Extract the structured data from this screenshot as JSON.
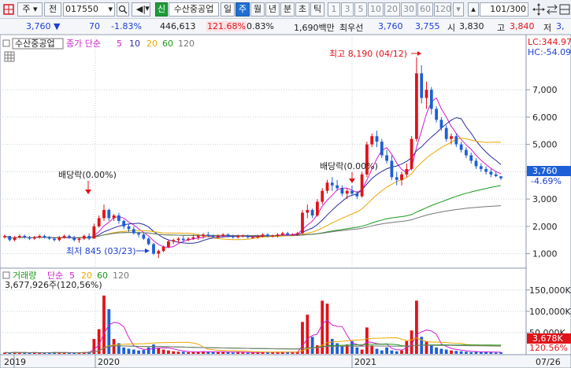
{
  "toolbar": {
    "market": "주",
    "cat": "전",
    "code": "017550",
    "stock_badge": "신",
    "stock_name": "수산중공업",
    "periods": [
      "일",
      "주",
      "월",
      "년",
      "분",
      "초",
      "틱"
    ],
    "active_period": "주",
    "intervals": [
      "1",
      "3",
      "5",
      "10",
      "20",
      "30",
      "60",
      "120"
    ],
    "count": "101",
    "count_total": "/300"
  },
  "quote": {
    "price": "3,760",
    "change": "70",
    "change_pct": "-1.83%",
    "volume": "446,613",
    "vol_ratio": "121.68%",
    "turnover": "0.83%",
    "amount": "1,690백만",
    "pref_label": "최우선",
    "ask": "3,760",
    "bid": "3,755",
    "open_label": "시",
    "open": "3,830",
    "high_label": "고",
    "high": "3,840",
    "low_label": "저",
    "low": "3,"
  },
  "chart_data": {
    "type": "candlestick",
    "price_legend": {
      "stock_name": "수산중공업",
      "ma_label": "종가 단순",
      "ma_periods": [
        "5",
        "10",
        "20",
        "60",
        "120"
      ],
      "ma_colors": [
        "#d01ed0",
        "#2a2aa0",
        "#e8a800",
        "#1a9a1a",
        "#777777"
      ]
    },
    "volume_legend": {
      "label": "거래량",
      "ma_label": "단순",
      "ma_periods": [
        "5",
        "20",
        "60",
        "120"
      ],
      "current": "3,677,926주(120,56%)"
    },
    "y_ticks_price": [
      "7,000",
      "6,000",
      "5,000",
      "4,000",
      "3,000",
      "2,000",
      "1,000"
    ],
    "y_ticks_volume": [
      "150,000K",
      "100,000K",
      "50,000K"
    ],
    "x_ticks": [
      "2019",
      "2020",
      "2021",
      "07/26"
    ],
    "lc": "LC:344.97",
    "hc": "HC:-54.09",
    "price_tag": "3,760",
    "price_tag_pct": "-4.69%",
    "volume_tag": "3,678K",
    "volume_tag_pct": "120.56%",
    "annotations": {
      "high": "최고 8,190 (04/12)",
      "low": "최저 845 (03/23)",
      "dividend": "배당락(0.00%)"
    },
    "y_range_price": [
      500,
      8500
    ],
    "y_range_volume": [
      0,
      170000
    ],
    "candles": [
      [
        1600,
        1700,
        1550,
        1650
      ],
      [
        1650,
        1650,
        1450,
        1500
      ],
      [
        1500,
        1650,
        1450,
        1600
      ],
      [
        1600,
        1700,
        1550,
        1650
      ],
      [
        1650,
        1700,
        1550,
        1600
      ],
      [
        1600,
        1650,
        1500,
        1550
      ],
      [
        1550,
        1650,
        1500,
        1600
      ],
      [
        1600,
        1700,
        1550,
        1650
      ],
      [
        1650,
        1700,
        1550,
        1600
      ],
      [
        1600,
        1650,
        1500,
        1550
      ],
      [
        1550,
        1600,
        1450,
        1500
      ],
      [
        1500,
        1650,
        1450,
        1600
      ],
      [
        1600,
        1700,
        1550,
        1650
      ],
      [
        1650,
        1700,
        1550,
        1600
      ],
      [
        1600,
        1650,
        1450,
        1500
      ],
      [
        1500,
        1600,
        1400,
        1550
      ],
      [
        1550,
        1700,
        1500,
        1650
      ],
      [
        1650,
        1750,
        1500,
        1550
      ],
      [
        1550,
        2100,
        1550,
        2000
      ],
      [
        2000,
        2400,
        1950,
        2300
      ],
      [
        2300,
        2800,
        2200,
        2600
      ],
      [
        2600,
        2650,
        2200,
        2300
      ],
      [
        2300,
        2450,
        2200,
        2400
      ],
      [
        2400,
        2500,
        2100,
        2200
      ],
      [
        2200,
        2250,
        1900,
        2000
      ],
      [
        2000,
        2100,
        1800,
        1900
      ],
      [
        1900,
        2000,
        1700,
        1750
      ],
      [
        1750,
        1800,
        1600,
        1700
      ],
      [
        1700,
        1750,
        1500,
        1550
      ],
      [
        1550,
        1600,
        1300,
        1350
      ],
      [
        1350,
        1400,
        950,
        1000
      ],
      [
        1000,
        1150,
        845,
        1100
      ],
      [
        1100,
        1300,
        1050,
        1250
      ],
      [
        1250,
        1500,
        1200,
        1450
      ],
      [
        1450,
        1550,
        1350,
        1500
      ],
      [
        1500,
        1600,
        1400,
        1550
      ],
      [
        1550,
        1650,
        1450,
        1500
      ],
      [
        1500,
        1600,
        1450,
        1550
      ],
      [
        1550,
        1700,
        1500,
        1600
      ],
      [
        1600,
        1700,
        1500,
        1650
      ],
      [
        1650,
        1750,
        1550,
        1700
      ],
      [
        1700,
        1800,
        1600,
        1650
      ],
      [
        1650,
        1700,
        1550,
        1600
      ],
      [
        1600,
        1700,
        1550,
        1650
      ],
      [
        1650,
        1750,
        1600,
        1700
      ],
      [
        1700,
        1750,
        1600,
        1650
      ],
      [
        1650,
        1700,
        1550,
        1600
      ],
      [
        1600,
        1700,
        1550,
        1650
      ],
      [
        1650,
        1700,
        1600,
        1650
      ],
      [
        1650,
        1700,
        1550,
        1600
      ],
      [
        1600,
        1650,
        1550,
        1600
      ],
      [
        1600,
        1700,
        1550,
        1650
      ],
      [
        1650,
        1750,
        1600,
        1700
      ],
      [
        1700,
        1750,
        1600,
        1650
      ],
      [
        1650,
        1700,
        1600,
        1650
      ],
      [
        1650,
        1750,
        1600,
        1700
      ],
      [
        1700,
        1800,
        1650,
        1750
      ],
      [
        1750,
        1800,
        1650,
        1700
      ],
      [
        1700,
        1750,
        1650,
        1700
      ],
      [
        1700,
        1800,
        1650,
        1750
      ],
      [
        1750,
        2600,
        1700,
        2500
      ],
      [
        2500,
        2800,
        2300,
        2600
      ],
      [
        2600,
        2650,
        2300,
        2400
      ],
      [
        2400,
        3000,
        2350,
        2900
      ],
      [
        2900,
        3400,
        2800,
        3300
      ],
      [
        3300,
        3700,
        3200,
        3600
      ],
      [
        3600,
        3800,
        3300,
        3500
      ],
      [
        3500,
        3700,
        3300,
        3400
      ],
      [
        3400,
        3500,
        3100,
        3200
      ],
      [
        3200,
        3400,
        3000,
        3300
      ],
      [
        3300,
        3500,
        3100,
        3200
      ],
      [
        3200,
        3300,
        3000,
        3100
      ],
      [
        3100,
        4000,
        3050,
        3900
      ],
      [
        3900,
        5100,
        3800,
        5000
      ],
      [
        5000,
        5400,
        4900,
        5300
      ],
      [
        5300,
        5500,
        4900,
        5100
      ],
      [
        5100,
        5200,
        4500,
        4600
      ],
      [
        4600,
        4800,
        4300,
        4400
      ],
      [
        4400,
        4600,
        3700,
        3800
      ],
      [
        3800,
        4000,
        3500,
        3700
      ],
      [
        3700,
        4000,
        3500,
        3900
      ],
      [
        3900,
        4300,
        3800,
        4100
      ],
      [
        4100,
        5300,
        4050,
        5200
      ],
      [
        5200,
        8190,
        5100,
        7600
      ],
      [
        7600,
        7900,
        6500,
        6700
      ],
      [
        6700,
        7300,
        6300,
        7000
      ],
      [
        7000,
        7100,
        6100,
        6300
      ],
      [
        6300,
        6400,
        5800,
        5900
      ],
      [
        5900,
        6000,
        5500,
        5600
      ],
      [
        5600,
        5700,
        5100,
        5200
      ],
      [
        5200,
        5400,
        5000,
        5300
      ],
      [
        5300,
        5400,
        4900,
        5000
      ],
      [
        5000,
        5100,
        4700,
        4800
      ],
      [
        4800,
        4900,
        4500,
        4600
      ],
      [
        4600,
        4700,
        4300,
        4400
      ],
      [
        4400,
        4500,
        4100,
        4200
      ],
      [
        4200,
        4300,
        4000,
        4100
      ],
      [
        4100,
        4200,
        3900,
        4000
      ],
      [
        4000,
        4100,
        3800,
        3900
      ],
      [
        3900,
        4000,
        3800,
        3840
      ],
      [
        3830,
        3840,
        3700,
        3760
      ]
    ],
    "volumes": [
      3000,
      2500,
      4000,
      2000,
      3000,
      2500,
      3500,
      2000,
      2500,
      3000,
      4000,
      2500,
      3000,
      2000,
      2500,
      3000,
      4000,
      5000,
      35000,
      58000,
      137000,
      105000,
      35000,
      25000,
      15000,
      12000,
      10000,
      8000,
      9000,
      15000,
      22000,
      14000,
      10000,
      8000,
      6000,
      5000,
      5000,
      4000,
      4000,
      5000,
      6000,
      5000,
      4000,
      4000,
      5000,
      4000,
      3000,
      4000,
      3500,
      3000,
      3000,
      4000,
      5000,
      4000,
      3500,
      4000,
      5000,
      4000,
      3500,
      5000,
      75000,
      92000,
      40000,
      20000,
      125000,
      118000,
      35000,
      25000,
      18000,
      22000,
      30000,
      15000,
      10000,
      62000,
      20000,
      12000,
      8000,
      15000,
      8000,
      6000,
      8000,
      30000,
      55000,
      125000,
      40000,
      30000,
      20000,
      15000,
      12000,
      10000,
      8000,
      7000,
      6000,
      5000,
      4000,
      5000,
      4000,
      5000,
      4000,
      3000,
      3678
    ]
  }
}
